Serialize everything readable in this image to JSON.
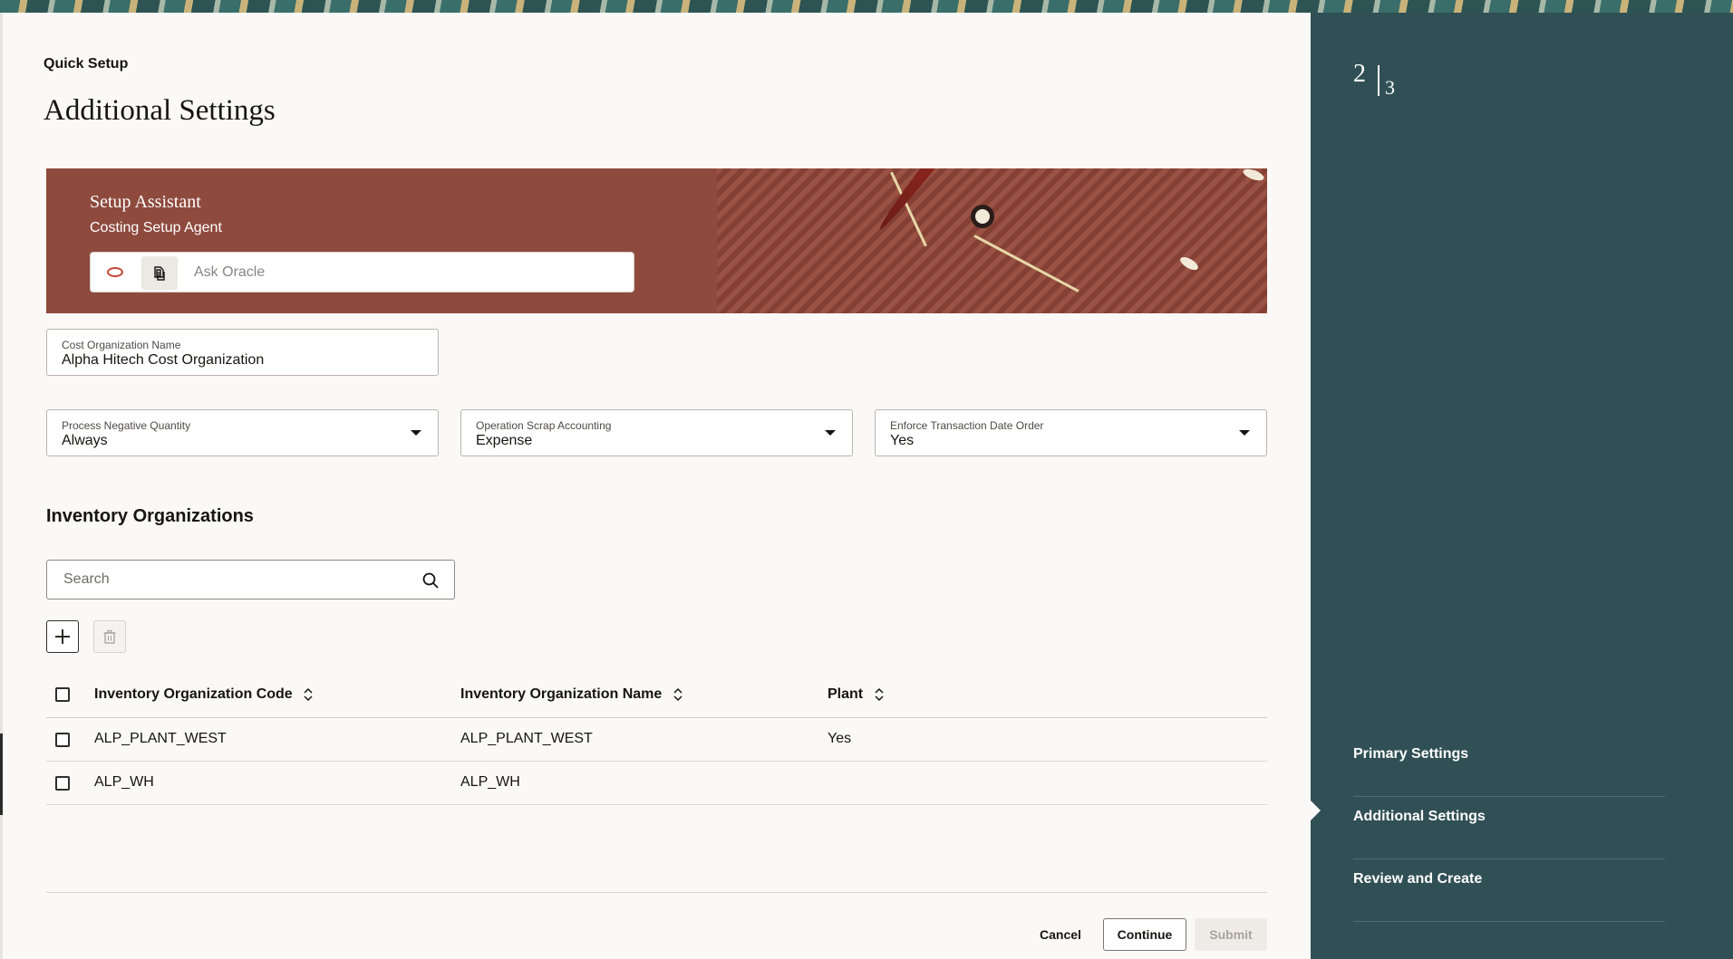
{
  "page": {
    "breadcrumb": "Quick Setup",
    "title": "Additional Settings"
  },
  "assistant": {
    "title": "Setup Assistant",
    "subtitle": "Costing Setup Agent",
    "placeholder": "Ask Oracle"
  },
  "fields": {
    "cost_org": {
      "label": "Cost Organization Name",
      "value": "Alpha Hitech Cost Organization"
    },
    "negative_qty": {
      "label": "Process Negative Quantity",
      "value": "Always"
    },
    "scrap_accounting": {
      "label": "Operation Scrap Accounting",
      "value": "Expense"
    },
    "date_order": {
      "label": "Enforce Transaction Date Order",
      "value": "Yes"
    }
  },
  "inventory": {
    "title": "Inventory Organizations",
    "search_placeholder": "Search",
    "columns": [
      "Inventory Organization Code",
      "Inventory Organization Name",
      "Plant"
    ],
    "rows": [
      {
        "code": "ALP_PLANT_WEST",
        "name": "ALP_PLANT_WEST",
        "plant": "Yes"
      },
      {
        "code": "ALP_WH",
        "name": "ALP_WH",
        "plant": ""
      }
    ]
  },
  "actions": {
    "cancel": "Cancel",
    "continue": "Continue",
    "submit": "Submit"
  },
  "steps": {
    "current": "2",
    "total": "3",
    "items": [
      "Primary Settings",
      "Additional Settings",
      "Review and Create"
    ]
  },
  "colors": {
    "assistant_bg": "#8e4a3d",
    "sidebar_bg": "#305055",
    "page_bg": "#fbf9f8"
  }
}
